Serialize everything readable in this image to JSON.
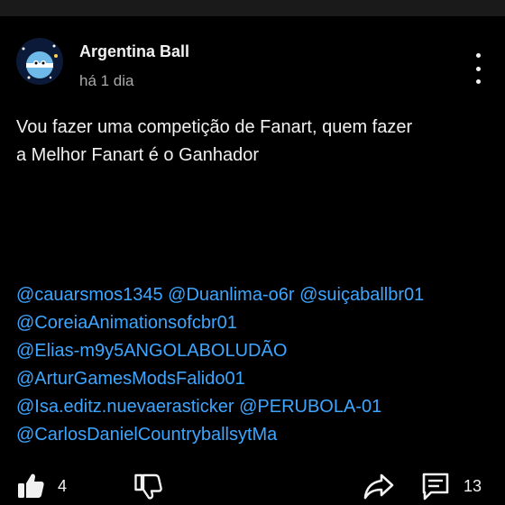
{
  "post": {
    "author": "Argentina Ball",
    "time": "há 1 dia",
    "text_lines": [
      "Vou fazer uma competição de Fanart, quem fazer",
      "a Melhor Fanart é o Ganhador"
    ],
    "mention_lines": [
      [
        "@cauarsmos1345",
        "@Duanlima-o6r",
        "@suiçaballbr01"
      ],
      [
        "@CoreiaAnimationsofcbr01"
      ],
      [
        "@Elias-m9y5ANGOLABOLUDÃO"
      ],
      [
        "@ArturGamesModsFalido01"
      ],
      [
        "@Isa.editz.nuevaerasticker",
        "@PERUBOLA-01"
      ],
      [
        "@CarlosDanielCountryballsytMa"
      ]
    ]
  },
  "actions": {
    "like_count": "4",
    "comment_count": "13"
  },
  "icons": {
    "avatar": "avatar-image",
    "menu": "more-vert-icon",
    "like": "thumbs-up-icon",
    "dislike": "thumbs-down-icon",
    "share": "share-arrow-icon",
    "comment": "comment-icon"
  },
  "colors": {
    "background": "#000000",
    "text": "#f1f1f1",
    "secondary": "#aaaaaa",
    "link": "#3ea6ff"
  }
}
